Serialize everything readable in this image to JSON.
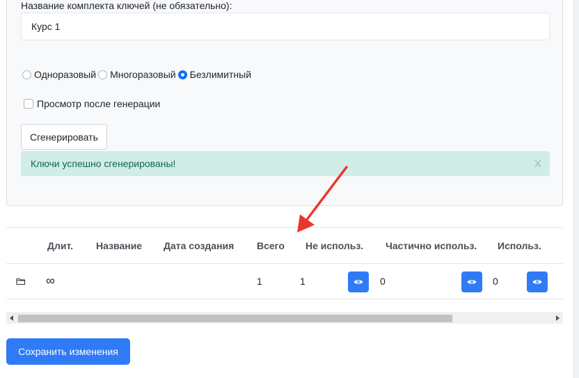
{
  "form": {
    "name_label": "Название комплекта ключей (не обязательно):",
    "name_value": "Курс 1",
    "radio_options": [
      {
        "label": "Одноразовый",
        "checked": false
      },
      {
        "label": "Многоразовый",
        "checked": false
      },
      {
        "label": "Безлимитный",
        "checked": true
      }
    ],
    "preview_checkbox_label": "Просмотр после генерации",
    "generate_button": "Сгенерировать",
    "alert_text": "Ключи успешно сгенерированы!",
    "alert_close": "X"
  },
  "table": {
    "headers": {
      "duration": "Длит.",
      "name": "Название",
      "created": "Дата создания",
      "total": "Всего",
      "unused": "Не использ.",
      "partial": "Частично использ.",
      "used": "Использ."
    },
    "rows": [
      {
        "duration": "∞",
        "name": "",
        "created": "",
        "total": "1",
        "unused": "1",
        "partial": "0",
        "used": "0"
      }
    ]
  },
  "save_button": "Сохранить изменения",
  "colors": {
    "primary": "#2f7bf5",
    "alert_bg": "#d1ede8",
    "alert_text": "#0f6848",
    "annotation_arrow": "#e8382d"
  },
  "icons": {
    "row": "folder-icon",
    "view": "eye-icon"
  }
}
